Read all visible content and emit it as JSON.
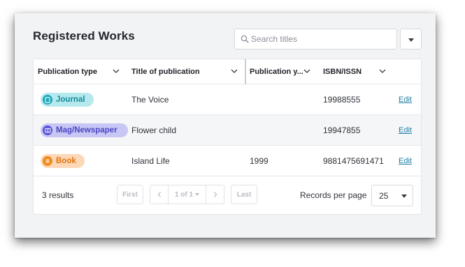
{
  "page": {
    "title": "Registered Works"
  },
  "search": {
    "placeholder": "Search titles",
    "icon": "search-icon"
  },
  "filter_dropdown": {
    "icon": "chevron-down-icon"
  },
  "table": {
    "columns": [
      {
        "label": "Publication type",
        "sortable": true
      },
      {
        "label": "Title of publication",
        "sortable": true
      },
      {
        "label": "Publication y...",
        "sortable": true
      },
      {
        "label": "ISBN/ISSN",
        "sortable": true
      }
    ],
    "rows": [
      {
        "type": "Journal",
        "type_icon": "journal-icon",
        "badge_bg": "#b6e9ee",
        "badge_fg": "#128c9c",
        "icon_bg": "#1aa7b8",
        "title": "The Voice",
        "year": "",
        "isbn": "19988555",
        "action": "Edit"
      },
      {
        "type": "Mag/Newspaper",
        "type_icon": "book-open-icon",
        "badge_bg": "#c8c6f5",
        "badge_fg": "#4a46c4",
        "icon_bg": "#5a55d6",
        "title": "Flower child",
        "year": "",
        "isbn": "19947855",
        "action": "Edit"
      },
      {
        "type": "Book",
        "type_icon": "book-icon",
        "badge_bg": "#fdd8b8",
        "badge_fg": "#e0740f",
        "icon_bg": "#f08a1c",
        "title": "Island Life",
        "year": "1999",
        "isbn": "9881475691471",
        "action": "Edit"
      }
    ]
  },
  "footer": {
    "results": "3 results",
    "first": "First",
    "page_indicator": "1 of 1",
    "last": "Last",
    "records_label": "Records per page",
    "records_value": "25"
  },
  "colors": {
    "link": "#1f7fa3",
    "disabled": "#b9bcc3"
  }
}
